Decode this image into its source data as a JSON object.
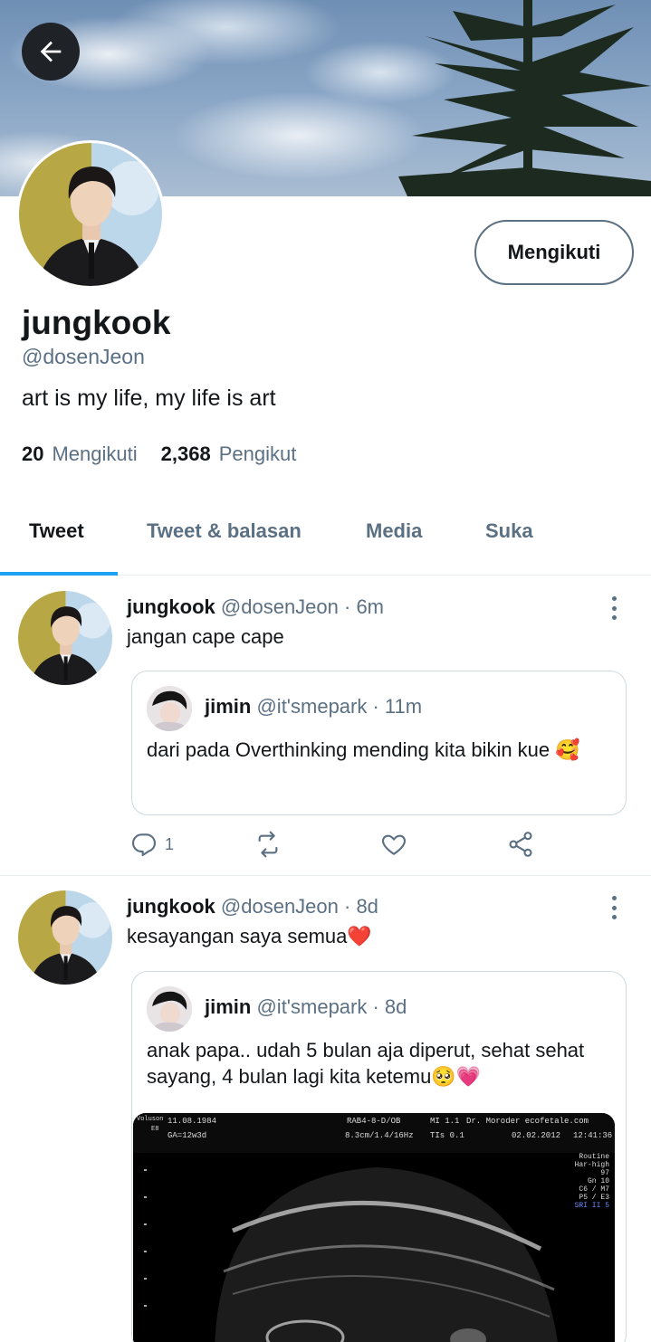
{
  "profile": {
    "back_label": "",
    "follow_button": "Mengikuti",
    "display_name": "jungkook",
    "handle": "@dosenJeon",
    "bio": "art is my life, my life is art",
    "following_count": "20",
    "following_label": "Mengikuti",
    "followers_count": "2,368",
    "followers_label": "Pengikut"
  },
  "tabs": [
    {
      "label": "Tweet",
      "active": true
    },
    {
      "label": "Tweet & balasan",
      "active": false
    },
    {
      "label": "Media",
      "active": false
    },
    {
      "label": "Suka",
      "active": false
    }
  ],
  "tweets": [
    {
      "name": "jungkook",
      "meta": "@dosenJeon · 6m",
      "text": "jangan cape cape",
      "quote": {
        "name": "jimin",
        "meta": "@it'smepark · 11m",
        "text": "dari pada Overthinking mending kita bikin kue 🥰"
      },
      "reply_count": "1"
    },
    {
      "name": "jungkook",
      "meta": "@dosenJeon · 8d",
      "text": "kesayangan saya semua❤️",
      "quote": {
        "name": "jimin",
        "meta": "@it'smepark · 8d",
        "text": "anak papa.. udah 5 bulan aja diperut, sehat sehat sayang, 4 bulan lagi kita ketemu🥺💗",
        "image_overlay": {
          "brand": "Voluson",
          "model": "E8",
          "date": "11.08.1984",
          "ga": "GA=12w3d",
          "probe": "RAB4-8-D/OB",
          "probe_params": "8.3cm/1.4/16Hz",
          "mi": "MI 1.1",
          "tis": "TIs 0.1",
          "doctor": "Dr. Moroder ecofetale.com",
          "exam_date": "02.02.2012",
          "time": "12:41:36",
          "side_params": [
            "Routine",
            "Har-high",
            "97",
            "Gn 10",
            "C6 / M7",
            "P5 / E3",
            "SRI II 5"
          ]
        }
      }
    }
  ],
  "colors": {
    "accent": "#1da1f2",
    "secondary_text": "#5b7083",
    "primary_text": "#14171a"
  }
}
